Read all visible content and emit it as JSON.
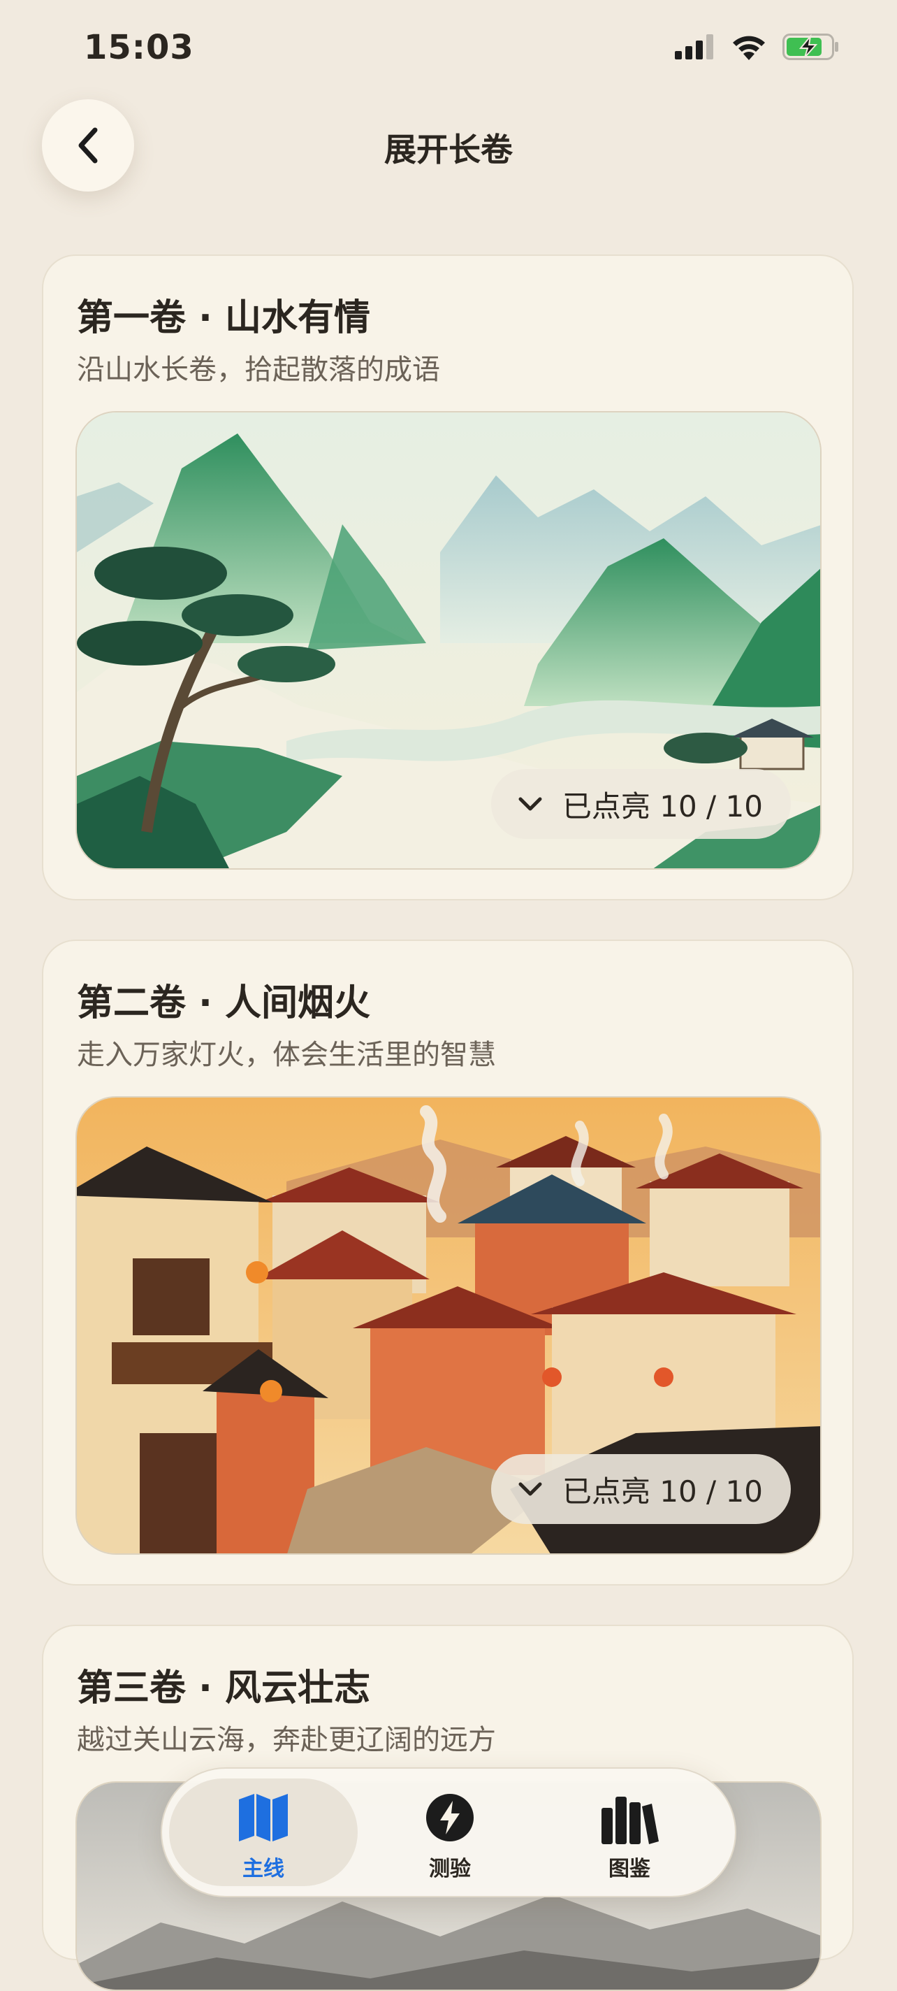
{
  "status": {
    "time": "15:03"
  },
  "header": {
    "title": "展开长卷",
    "back_icon": "chevron-left-icon"
  },
  "cards": [
    {
      "title": "第一卷 · 山水有情",
      "subtitle": "沿山水长卷，拾起散落的成语",
      "progress_label": "已点亮 10 / 10",
      "lit": 10,
      "total": 10
    },
    {
      "title": "第二卷 · 人间烟火",
      "subtitle": "走入万家灯火，体会生活里的智慧",
      "progress_label": "已点亮 10 / 10",
      "lit": 10,
      "total": 10
    },
    {
      "title": "第三卷 · 风云壮志",
      "subtitle": "越过关山云海，奔赴更辽阔的远方"
    }
  ],
  "tabbar": {
    "tabs": [
      {
        "label": "主线",
        "icon": "map-icon",
        "active": true
      },
      {
        "label": "测验",
        "icon": "lightning-icon",
        "active": false
      },
      {
        "label": "图鉴",
        "icon": "books-icon",
        "active": false
      }
    ]
  },
  "colors": {
    "accent": "#1e6fe0",
    "background": "#f1eadf",
    "card": "#f8f3e8"
  }
}
